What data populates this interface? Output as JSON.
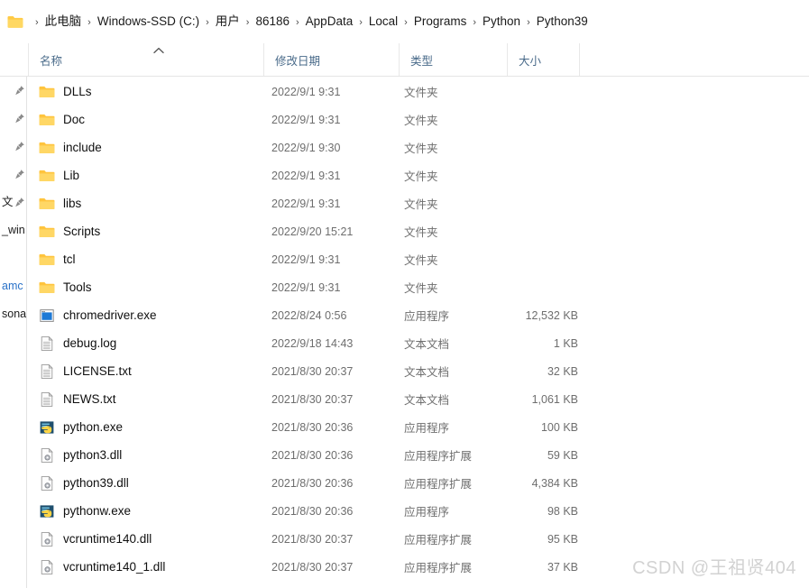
{
  "addressbar": {
    "folder_icon": "folder-icon",
    "separator": "›",
    "crumbs": [
      "此电脑",
      "Windows-SSD (C:)",
      "用户",
      "86186",
      "AppData",
      "Local",
      "Programs",
      "Python",
      "Python39"
    ]
  },
  "columns": {
    "name": "名称",
    "date_modified": "修改日期",
    "type": "类型",
    "size": "大小",
    "sort_indicator": "sort-ascending-icon"
  },
  "navpane": {
    "items": [
      {
        "label": "",
        "pin": true
      },
      {
        "label": "",
        "pin": true
      },
      {
        "label": "",
        "pin": true
      },
      {
        "label": "",
        "pin": true
      },
      {
        "label": "文",
        "pin": true
      },
      {
        "label": "_win",
        "pin": false
      },
      {
        "label": "",
        "pin": false
      },
      {
        "label": "amc",
        "pin": false,
        "link": true
      },
      {
        "label": "sona",
        "pin": false
      }
    ]
  },
  "files": [
    {
      "name": "DLLs",
      "icon": "folder-icon",
      "date": "2022/9/1 9:31",
      "type": "文件夹",
      "size": ""
    },
    {
      "name": "Doc",
      "icon": "folder-icon",
      "date": "2022/9/1 9:31",
      "type": "文件夹",
      "size": ""
    },
    {
      "name": "include",
      "icon": "folder-icon",
      "date": "2022/9/1 9:30",
      "type": "文件夹",
      "size": ""
    },
    {
      "name": "Lib",
      "icon": "folder-icon",
      "date": "2022/9/1 9:31",
      "type": "文件夹",
      "size": ""
    },
    {
      "name": "libs",
      "icon": "folder-icon",
      "date": "2022/9/1 9:31",
      "type": "文件夹",
      "size": ""
    },
    {
      "name": "Scripts",
      "icon": "folder-icon",
      "date": "2022/9/20 15:21",
      "type": "文件夹",
      "size": ""
    },
    {
      "name": "tcl",
      "icon": "folder-icon",
      "date": "2022/9/1 9:31",
      "type": "文件夹",
      "size": ""
    },
    {
      "name": "Tools",
      "icon": "folder-icon",
      "date": "2022/9/1 9:31",
      "type": "文件夹",
      "size": ""
    },
    {
      "name": "chromedriver.exe",
      "icon": "application-icon",
      "date": "2022/8/24 0:56",
      "type": "应用程序",
      "size": "12,532 KB"
    },
    {
      "name": "debug.log",
      "icon": "text-file-icon",
      "date": "2022/9/18 14:43",
      "type": "文本文档",
      "size": "1 KB"
    },
    {
      "name": "LICENSE.txt",
      "icon": "text-file-icon",
      "date": "2021/8/30 20:37",
      "type": "文本文档",
      "size": "32 KB"
    },
    {
      "name": "NEWS.txt",
      "icon": "text-file-icon",
      "date": "2021/8/30 20:37",
      "type": "文本文档",
      "size": "1,061 KB"
    },
    {
      "name": "python.exe",
      "icon": "python-icon",
      "date": "2021/8/30 20:36",
      "type": "应用程序",
      "size": "100 KB"
    },
    {
      "name": "python3.dll",
      "icon": "dll-file-icon",
      "date": "2021/8/30 20:36",
      "type": "应用程序扩展",
      "size": "59 KB"
    },
    {
      "name": "python39.dll",
      "icon": "dll-file-icon",
      "date": "2021/8/30 20:36",
      "type": "应用程序扩展",
      "size": "4,384 KB"
    },
    {
      "name": "pythonw.exe",
      "icon": "python-icon",
      "date": "2021/8/30 20:36",
      "type": "应用程序",
      "size": "98 KB"
    },
    {
      "name": "vcruntime140.dll",
      "icon": "dll-file-icon",
      "date": "2021/8/30 20:37",
      "type": "应用程序扩展",
      "size": "95 KB"
    },
    {
      "name": "vcruntime140_1.dll",
      "icon": "dll-file-icon",
      "date": "2021/8/30 20:37",
      "type": "应用程序扩展",
      "size": "37 KB"
    }
  ],
  "watermark": "CSDN @王祖贤404",
  "colors": {
    "folder_yellow": "#FFC societies",
    "header_text": "#4a6b8a",
    "secondary_text": "#6e6e6e"
  }
}
